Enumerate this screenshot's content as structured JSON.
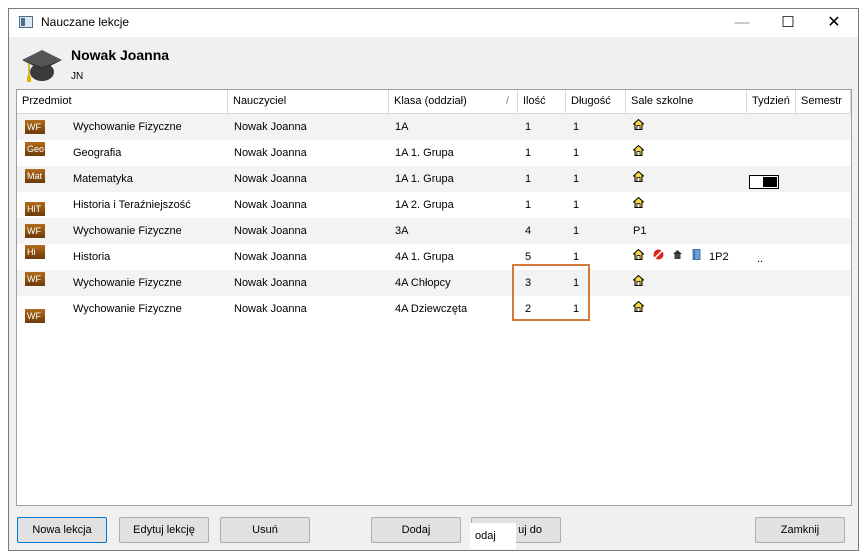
{
  "window": {
    "title": "Nauczane lekcje",
    "min": "—",
    "max": "☐",
    "close": "✕"
  },
  "teacher": {
    "name": "Nowak Joanna",
    "code": "JN"
  },
  "columns": [
    "Przedmiot",
    "Nauczyciel",
    "Klasa (oddział)",
    "Ilość",
    "Długość",
    "Sale szkolne",
    "Tydzień",
    "Semestr"
  ],
  "rows": [
    {
      "badge": "WF",
      "subject": "Wychowanie Fizyczne",
      "teacher": "Nowak Joanna",
      "class": "1A",
      "count": "1",
      "length": "1",
      "room": ""
    },
    {
      "badge": "Geo",
      "subject": "Geografia",
      "teacher": "Nowak Joanna",
      "class": "1A 1. Grupa",
      "count": "1",
      "length": "1",
      "room": ""
    },
    {
      "badge": "Mat",
      "subject": "Matematyka",
      "teacher": "Nowak Joanna",
      "class": "1A 1. Grupa",
      "count": "1",
      "length": "1",
      "room": ""
    },
    {
      "badge": "HiT",
      "subject": "Historia i Teraźniejszość",
      "teacher": "Nowak Joanna",
      "class": "1A 2. Grupa",
      "count": "1",
      "length": "1",
      "room": ""
    },
    {
      "badge": "WF",
      "subject": "Wychowanie Fizyczne",
      "teacher": "Nowak Joanna",
      "class": "3A",
      "count": "4",
      "length": "1",
      "room": "P1"
    },
    {
      "badge": "Hi",
      "subject": "Historia",
      "teacher": "Nowak Joanna",
      "class": "4A 1. Grupa",
      "count": "5",
      "length": "1",
      "room": "1P2",
      "week": ".."
    },
    {
      "badge": "WF",
      "subject": "Wychowanie Fizyczne",
      "teacher": "Nowak Joanna",
      "class": "4A Chłopcy",
      "count": "3",
      "length": "1",
      "room": ""
    },
    {
      "badge": "WF",
      "subject": "Wychowanie Fizyczne",
      "teacher": "Nowak Joanna",
      "class": "4A Dziewczęta",
      "count": "2",
      "length": "1",
      "room": ""
    }
  ],
  "buttons": {
    "new": "Nowa lekcja",
    "edit": "Edytuj lekcję",
    "delete": "Usuń",
    "add": "Dodaj",
    "add_to_overlay": "odaj",
    "add_to_suffix": "uj do",
    "close": "Zamknij"
  },
  "colors": {
    "highlight": "#d4793a",
    "badge": "#8b4f10"
  }
}
